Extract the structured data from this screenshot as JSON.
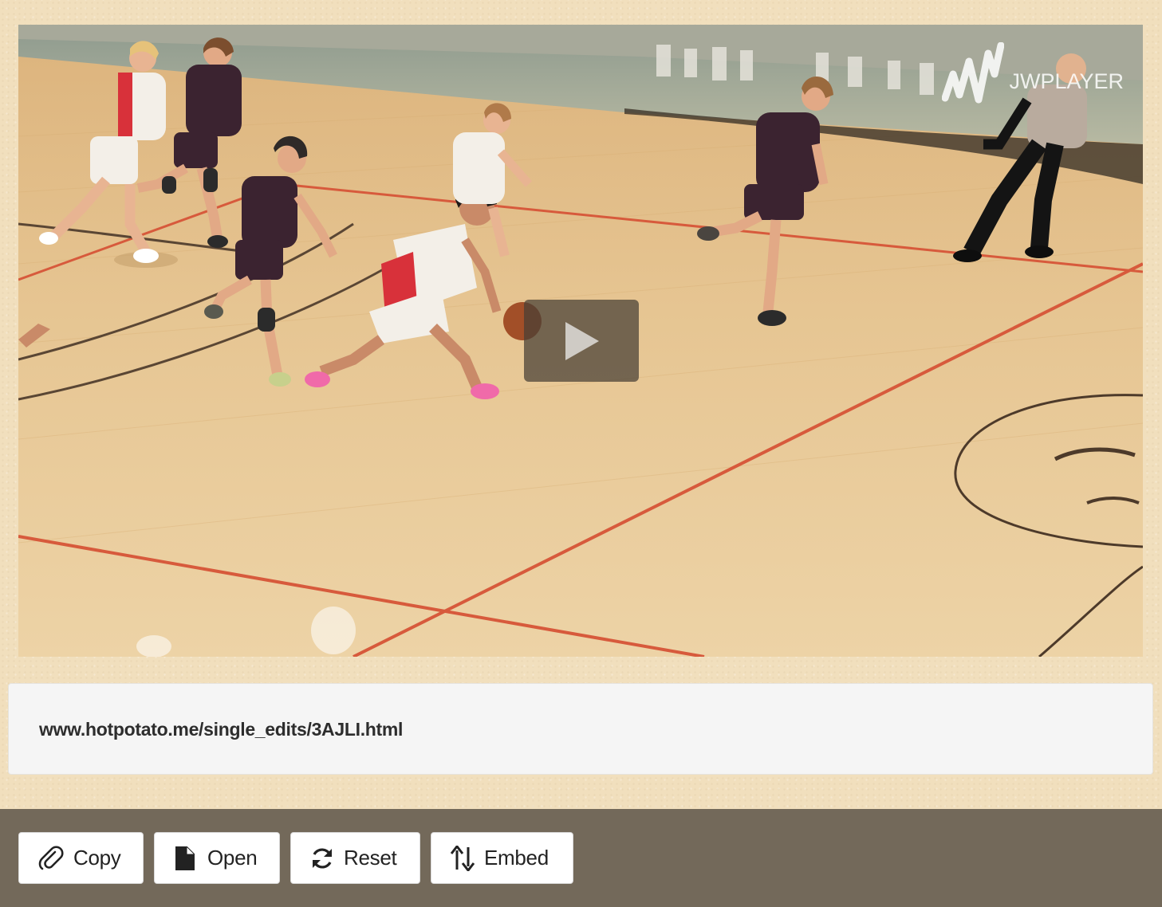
{
  "video": {
    "watermark": "JWPLAYER",
    "play_icon": "play-icon"
  },
  "share": {
    "url": "www.hotpotato.me/single_edits/3AJLI.html"
  },
  "toolbar": {
    "buttons": [
      {
        "label": "Copy",
        "icon": "paperclip-icon"
      },
      {
        "label": "Open",
        "icon": "file-icon"
      },
      {
        "label": "Reset",
        "icon": "refresh-icon"
      },
      {
        "label": "Embed",
        "icon": "sort-arrows-icon"
      }
    ]
  },
  "colors": {
    "page_background": "#f1dfbd",
    "toolbar_background": "#73695a",
    "url_box_background": "#f5f5f5",
    "court_wood": "#e4c18a",
    "home_jersey": "#d8313a",
    "away_jersey": "#3b2330"
  }
}
